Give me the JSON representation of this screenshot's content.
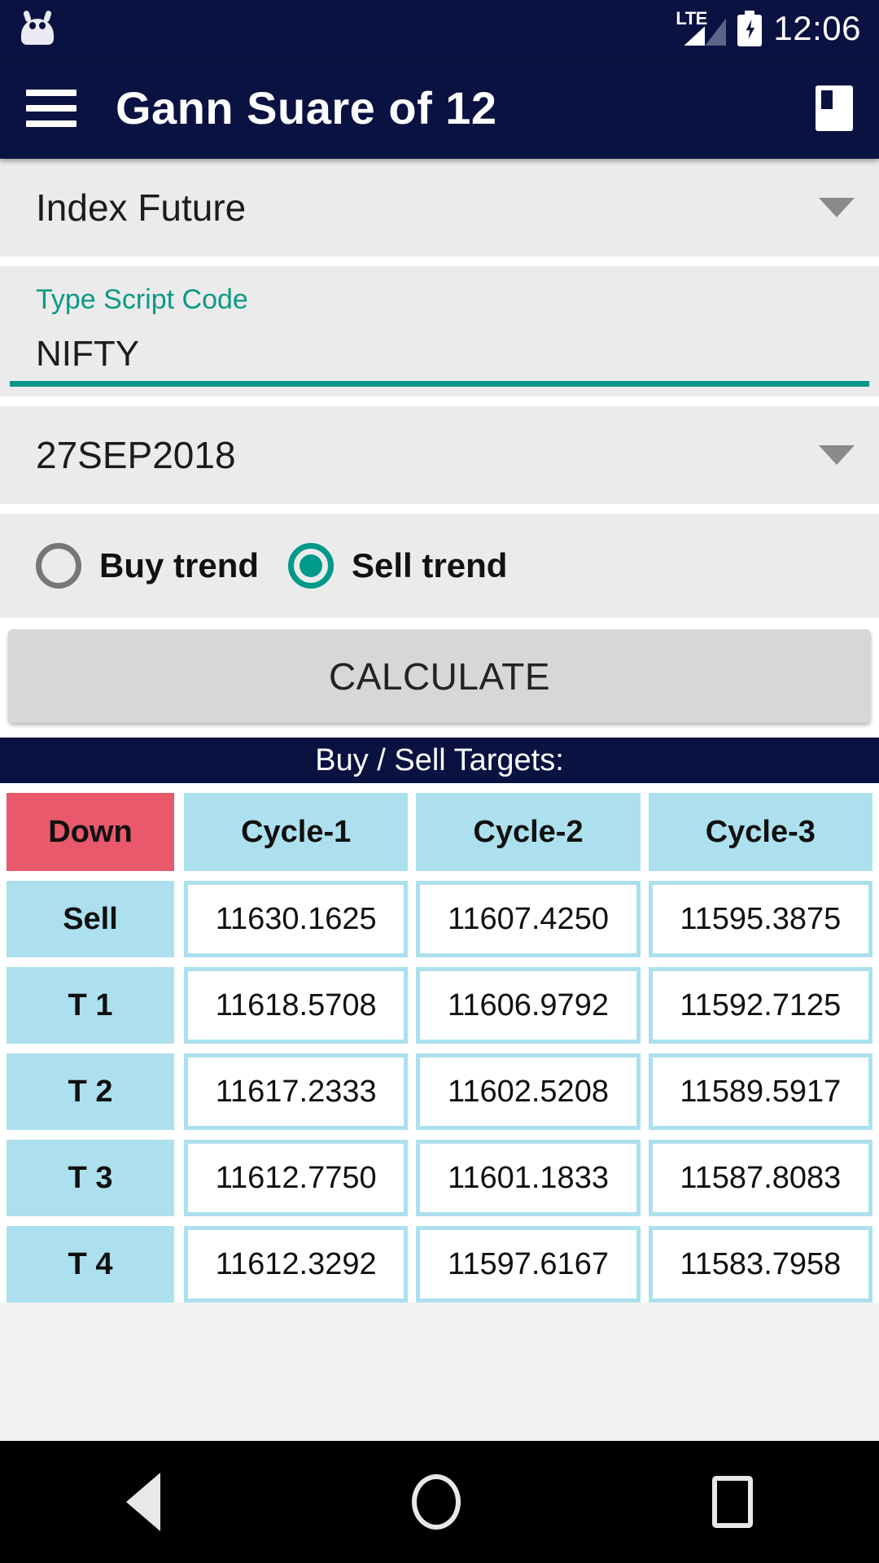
{
  "status_bar": {
    "notification_icon": "android-robot-icon",
    "network_label": "LTE",
    "signal_icon": "signal-bars-icon",
    "battery_icon": "battery-charging-icon",
    "time": "12:06"
  },
  "toolbar": {
    "menu_icon": "hamburger-menu-icon",
    "title": "Gann Suare of 12",
    "action_icon": "document-bookmark-icon"
  },
  "form": {
    "instrument": {
      "value": "Index Future",
      "caret_icon": "chevron-down-icon"
    },
    "script_code": {
      "label": "Type Script Code",
      "value": "NIFTY",
      "placeholder": "Type Script Code"
    },
    "expiry": {
      "value": "27SEP2018",
      "caret_icon": "chevron-down-icon"
    },
    "trend": {
      "options": [
        {
          "label": "Buy trend",
          "selected": false
        },
        {
          "label": "Sell trend",
          "selected": true
        }
      ]
    },
    "calculate_label": "CALCULATE"
  },
  "results": {
    "banner": "Buy / Sell Targets:",
    "corner_label": "Down",
    "columns": [
      "Cycle-1",
      "Cycle-2",
      "Cycle-3"
    ],
    "rows": [
      {
        "label": "Sell",
        "values": [
          "11630.1625",
          "11607.4250",
          "11595.3875"
        ]
      },
      {
        "label": "T 1",
        "values": [
          "11618.5708",
          "11606.9792",
          "11592.7125"
        ]
      },
      {
        "label": "T 2",
        "values": [
          "11617.2333",
          "11602.5208",
          "11589.5917"
        ]
      },
      {
        "label": "T 3",
        "values": [
          "11612.7750",
          "11601.1833",
          "11587.8083"
        ]
      },
      {
        "label": "T 4",
        "values": [
          "11612.3292",
          "11597.6167",
          "11583.7958"
        ]
      }
    ]
  },
  "navbar": {
    "back_icon": "back-triangle-icon",
    "home_icon": "home-circle-icon",
    "recents_icon": "recents-square-icon"
  },
  "colors": {
    "primary": "#0a1242",
    "accent": "#009688",
    "header_red": "#e8596c",
    "header_blue": "#ace0ee",
    "surface": "#ebebeb"
  }
}
